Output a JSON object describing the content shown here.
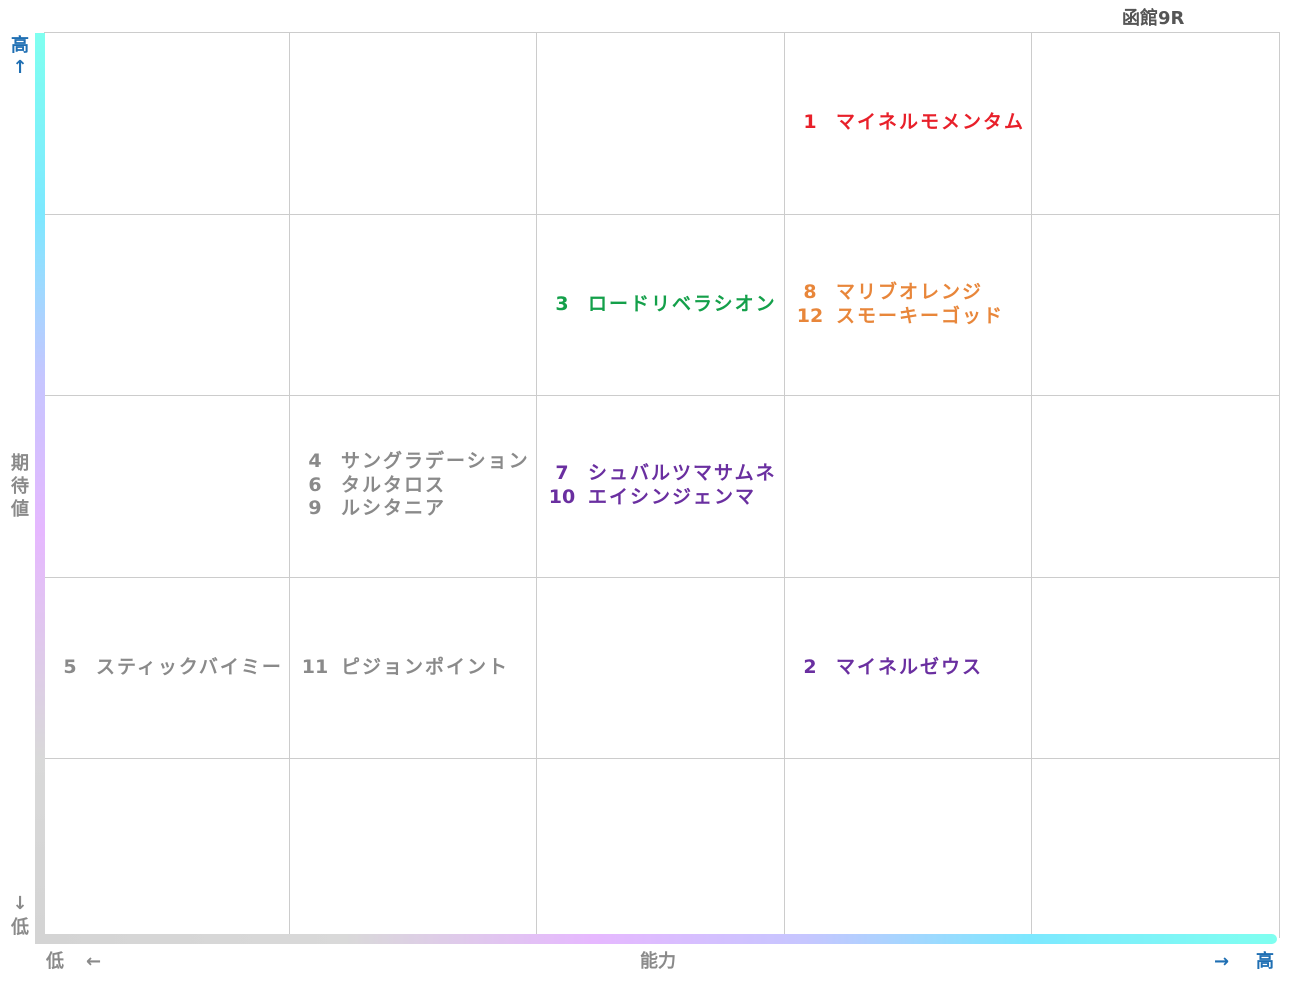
{
  "title": "函館9R",
  "chart_data": {
    "type": "table",
    "x_axis": {
      "label": "能力",
      "low": "低",
      "high": "高",
      "low_arrow": "←",
      "high_arrow": "→"
    },
    "y_axis": {
      "label": [
        "期",
        "待",
        "値"
      ],
      "high": "高",
      "high_arrow": "↑",
      "low": "低",
      "low_arrow": "↓"
    },
    "grid": {
      "columns": 5,
      "rows": 5
    },
    "horses": [
      {
        "num": "1",
        "name": "マイネルモメンタム",
        "col": 4,
        "row": 1,
        "color": "#e8202a"
      },
      {
        "num": "3",
        "name": "ロードリベラシオン",
        "col": 3,
        "row": 2,
        "color": "#14a04a"
      },
      {
        "num": "8",
        "name": "マリブオレンジ",
        "col": 4,
        "row": 2,
        "color": "#e8863a"
      },
      {
        "num": "12",
        "name": "スモーキーゴッド",
        "col": 4,
        "row": 2,
        "color": "#e8863a"
      },
      {
        "num": "4",
        "name": "サングラデーション",
        "col": 2,
        "row": 3,
        "color": "#8a8a8a"
      },
      {
        "num": "6",
        "name": "タルタロス",
        "col": 2,
        "row": 3,
        "color": "#8a8a8a"
      },
      {
        "num": "9",
        "name": "ルシタニア",
        "col": 2,
        "row": 3,
        "color": "#8a8a8a"
      },
      {
        "num": "7",
        "name": "シュバルツマサムネ",
        "col": 3,
        "row": 3,
        "color": "#6a2fa0"
      },
      {
        "num": "10",
        "name": "エイシンジェンマ",
        "col": 3,
        "row": 3,
        "color": "#6a2fa0"
      },
      {
        "num": "5",
        "name": "スティックバイミー",
        "col": 1,
        "row": 4,
        "color": "#8a8a8a"
      },
      {
        "num": "11",
        "name": "ピジョンポイント",
        "col": 2,
        "row": 4,
        "color": "#8a8a8a"
      },
      {
        "num": "2",
        "name": "マイネルゼウス",
        "col": 4,
        "row": 4,
        "color": "#6a2fa0"
      }
    ]
  }
}
